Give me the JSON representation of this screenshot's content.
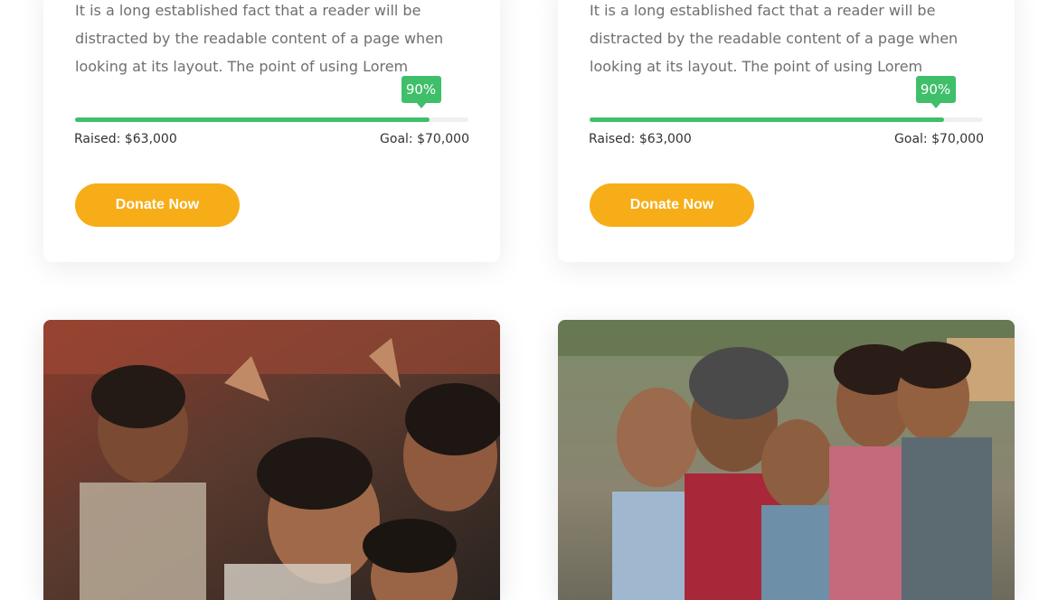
{
  "campaigns": [
    {
      "description": "It is a long established fact that a reader will be distracted by the readable content of a page when looking at its layout. The point of using Lorem",
      "progress_label": "90%",
      "progress_fraction": 0.9,
      "raised": "Raised: $63,000",
      "goal": "Goal: $70,000",
      "donate_label": "Donate Now"
    },
    {
      "description": "It is a long established fact that a reader will be distracted by the readable content of a page when looking at its layout. The point of using Lorem",
      "progress_label": "90%",
      "progress_fraction": 0.9,
      "raised": "Raised: $63,000",
      "goal": "Goal: $70,000",
      "donate_label": "Donate Now"
    }
  ],
  "colors": {
    "accent_green": "#3fbf6a",
    "button_orange": "#f7ad18",
    "text_gray": "#6f6f6f"
  }
}
